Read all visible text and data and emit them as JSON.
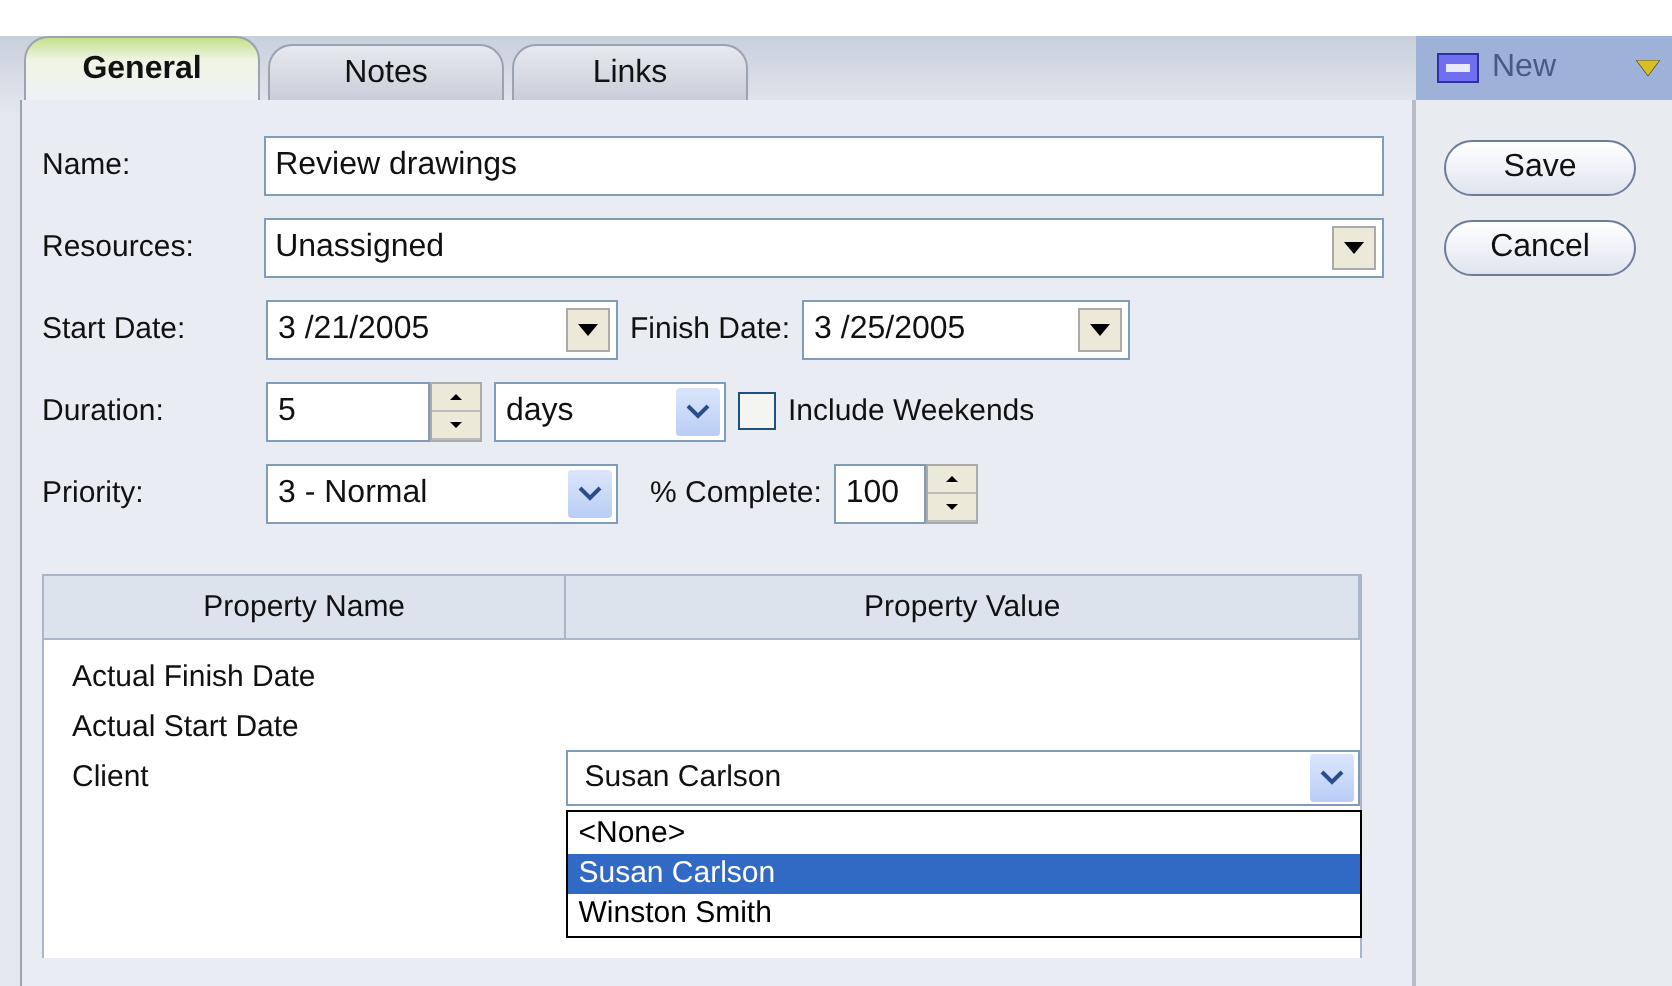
{
  "tabs": [
    {
      "label": "General",
      "selected": true
    },
    {
      "label": "Notes",
      "selected": false
    },
    {
      "label": "Links",
      "selected": false
    }
  ],
  "toolbar": {
    "new_button": {
      "label": "New",
      "disabled": true
    }
  },
  "buttons": [
    "Save",
    "Cancel"
  ],
  "form": {
    "name": {
      "label": "Name:",
      "value": "Review drawings"
    },
    "resources": {
      "label": "Resources:",
      "value": "Unassigned"
    },
    "start_date": {
      "label": "Start Date:",
      "value": "3 /21/2005"
    },
    "finish_date": {
      "label": "Finish Date:",
      "value": "3 /25/2005"
    },
    "duration": {
      "label": "Duration:",
      "value": "5",
      "unit": "days"
    },
    "include_weekends": {
      "label": "Include Weekends",
      "checked": false
    },
    "priority": {
      "label": "Priority:",
      "value": "3 - Normal"
    },
    "percent_complete": {
      "label": "% Complete:",
      "value": "100"
    }
  },
  "table": {
    "columns": [
      "Property Name",
      "Property Value"
    ],
    "rows": [
      {
        "name": "Actual Finish Date"
      },
      {
        "name": "Actual Start Date"
      },
      {
        "name": "Client",
        "value": "Susan Carlson",
        "options": [
          {
            "label": "<None>",
            "selected": false
          },
          {
            "label": "Susan Carlson",
            "selected": true
          },
          {
            "label": "Winston Smith",
            "selected": false
          }
        ]
      }
    ]
  }
}
